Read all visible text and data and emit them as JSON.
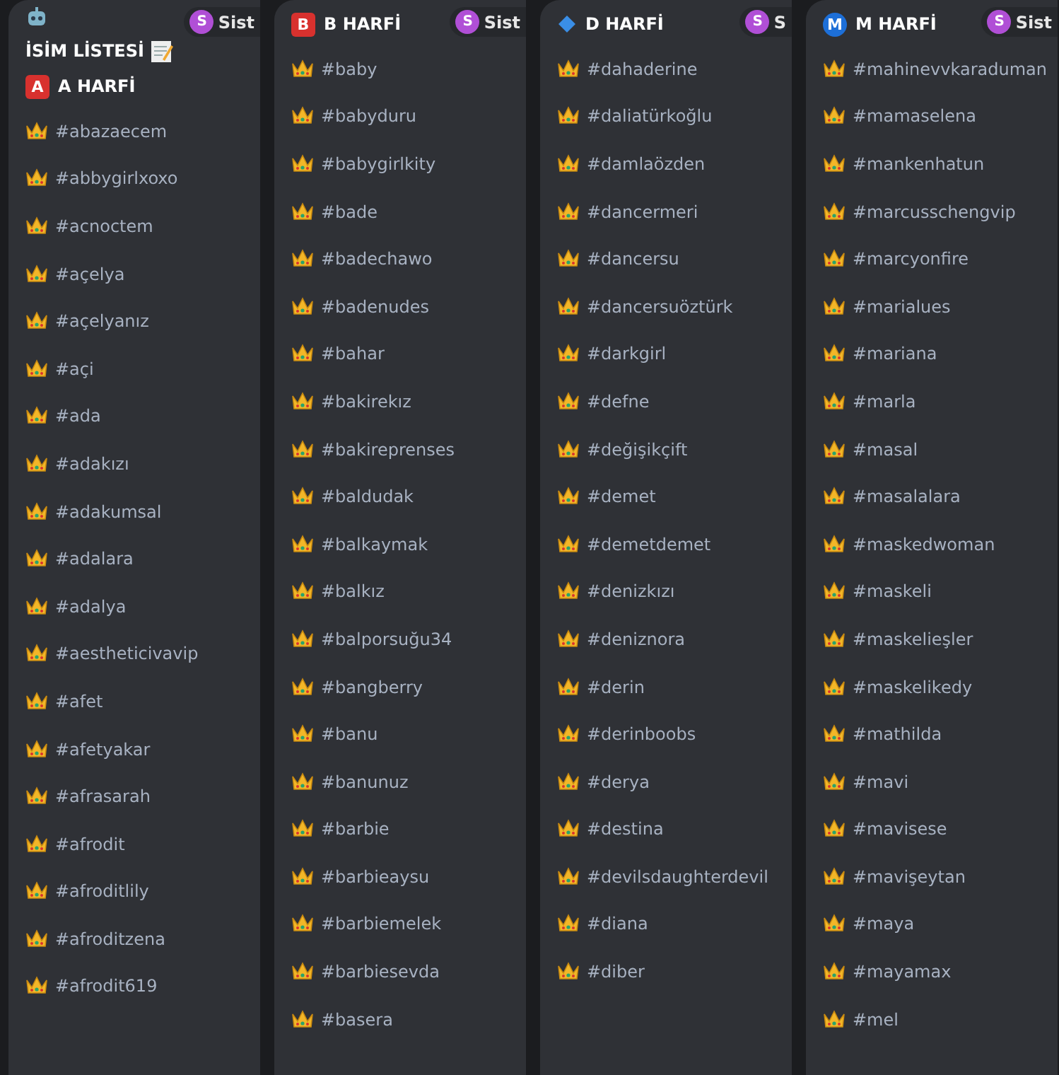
{
  "columns": [
    {
      "badge": {
        "avatar": "S",
        "text": "Sist"
      },
      "intro": "İSİM LİSTESİ",
      "section": {
        "kind": "square",
        "letter": "A",
        "title": "A HARFİ"
      },
      "items": [
        "#abazaecem",
        "#abbygirlxoxo",
        "#acnoctem",
        "#açelya",
        "#açelyanız",
        "#açi",
        "#ada",
        "#adakızı",
        "#adakumsal",
        "#adalara",
        "#adalya",
        "#aestheticivavip",
        "#afet",
        "#afetyakar",
        "#afrasarah",
        "#afrodit",
        "#afroditlily",
        "#afroditzena",
        "#afrodit619"
      ]
    },
    {
      "badge": {
        "avatar": "S",
        "text": "Sist"
      },
      "section": {
        "kind": "square",
        "letter": "B",
        "title": "B HARFİ"
      },
      "items": [
        "#baby",
        "#babyduru",
        "#babygirlkity",
        "#bade",
        "#badechawo",
        "#badenudes",
        "#bahar",
        "#bakirekız",
        "#bakireprenses",
        "#baldudak",
        "#balkaymak",
        "#balkız",
        "#balporsuğu34",
        "#bangberry",
        "#banu",
        "#banunuz",
        "#barbie",
        "#barbieaysu",
        "#barbiemelek",
        "#barbiesevda",
        "#basera"
      ]
    },
    {
      "badge": {
        "avatar": "S",
        "text": "S"
      },
      "section": {
        "kind": "diamond",
        "title": "D HARFİ"
      },
      "items": [
        "#dahaderine",
        "#daliatürkoğlu",
        "#damlaözden",
        "#dancermeri",
        "#dancersu",
        "#dancersuöztürk",
        "#darkgirl",
        "#defne",
        "#değişikçift",
        "#demet",
        "#demetdemet",
        "#denizkızı",
        "#deniznora",
        "#derin",
        "#derinboobs",
        "#derya",
        "#destina",
        "#devilsdaughterdevil",
        "#diana",
        "#diber"
      ]
    },
    {
      "badge": {
        "avatar": "S",
        "text": "Sist"
      },
      "section": {
        "kind": "circle",
        "letter": "M",
        "title": "M HARFİ"
      },
      "items": [
        "#mahinevvkaraduman",
        "#mamaselena",
        "#mankenhatun",
        "#marcusschengvip",
        "#marcyonfire",
        "#marialues",
        "#mariana",
        "#marla",
        "#masal",
        "#masalalara",
        "#maskedwoman",
        "#maskeli",
        "#maskelieşler",
        "#maskelikedy",
        "#mathilda",
        "#mavi",
        "#mavisese",
        "#mavişeytan",
        "#maya",
        "#mayamax",
        "#mel"
      ]
    }
  ]
}
